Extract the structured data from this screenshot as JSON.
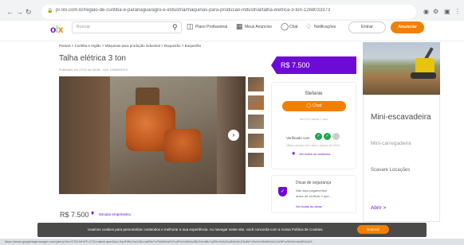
{
  "browser": {
    "back_icon": "back-arrow-icon",
    "forward_icon": "forward-arrow-icon",
    "reload_icon": "reload-icon",
    "url": "pr.olx.com.br/regiao-de-curitiba-e-paranagua/agro-e-industria/maquinas-para-producao-industrial/talha-eletrica-3-ton-1268033373"
  },
  "header": {
    "logo": "olx",
    "search_placeholder": "Buscar",
    "nav_items": [
      "Plano Profissional",
      "Meus Anúncios",
      "Chat",
      "Notificações"
    ],
    "login_label": "Entrar",
    "post_label": "Anunciar"
  },
  "listing": {
    "breadcrumb": "Paraná  >  Curitiba e região  >  Máquinas para produção industrial  >  Boqueirão  >  Boqueirão",
    "title": "Talha elétrica 3 ton",
    "meta": "Publicado em 07/11 às 08:08  -  cód. 1268033373",
    "price": "R$ 7.500",
    "similar_link": "Simular empréstimo"
  },
  "seller": {
    "price_tag": "R$ 7.500",
    "name": "Stefanie",
    "chat_label": "Chat",
    "member_since": "Na OLX desde 1 ano",
    "verified_label": "Verificado com",
    "last_access": "Último acesso há 4 dias  |  Janeiro de 2019",
    "all_ads": "Ver todos os anúncios"
  },
  "safety": {
    "title": "Dicas de segurança",
    "text_line1": "Não faça pagamentos",
    "text_line2": "antes de verificar o que...",
    "link": "Ver todas as dicas"
  },
  "ad": {
    "heading": "Mini-escavadeira",
    "subheading": "Mini-carregadeira",
    "advertiser": "Scavare Locações",
    "cta": "Abrir  >"
  },
  "cookie": {
    "text": "Usamos cookies para personalizar conteúdos e melhorar a sua experiência. Ao navegar neste site, você concorda com a nossa Política de Cookies.",
    "button": "Entendi"
  },
  "status_url": "https://www.googletagmanager.com/gtm.js?id=GTM-NH4TLG7&l=dataLayer&cb=3ad1f9b24e2d5c1a8f0e7c93d4b6a51f2c87e0d3b9a4f6c2e1d8b7a3f5c9e0d2a4b6c8e1f3a5b7d9c2e4f6a8b0d1c3e5f7a9b2d4c6e8f0a1b3"
}
